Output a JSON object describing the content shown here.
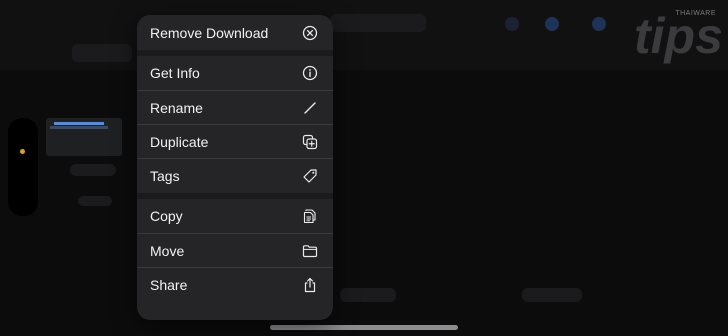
{
  "menu": {
    "items": [
      {
        "label": "Remove Download",
        "icon": "remove-download-icon"
      },
      {
        "label": "Get Info",
        "icon": "info-icon"
      },
      {
        "label": "Rename",
        "icon": "pencil-icon"
      },
      {
        "label": "Duplicate",
        "icon": "duplicate-icon"
      },
      {
        "label": "Tags",
        "icon": "tag-icon"
      },
      {
        "label": "Copy",
        "icon": "copy-icon"
      },
      {
        "label": "Move",
        "icon": "folder-icon"
      },
      {
        "label": "Share",
        "icon": "share-icon"
      }
    ]
  },
  "watermark": {
    "brand_small": "THAIWARE",
    "brand_large": "tips"
  },
  "colors": {
    "menu_bg": "#252527",
    "accent_blue": "#4a8ef0",
    "indicator_yellow": "#d8a21a"
  }
}
